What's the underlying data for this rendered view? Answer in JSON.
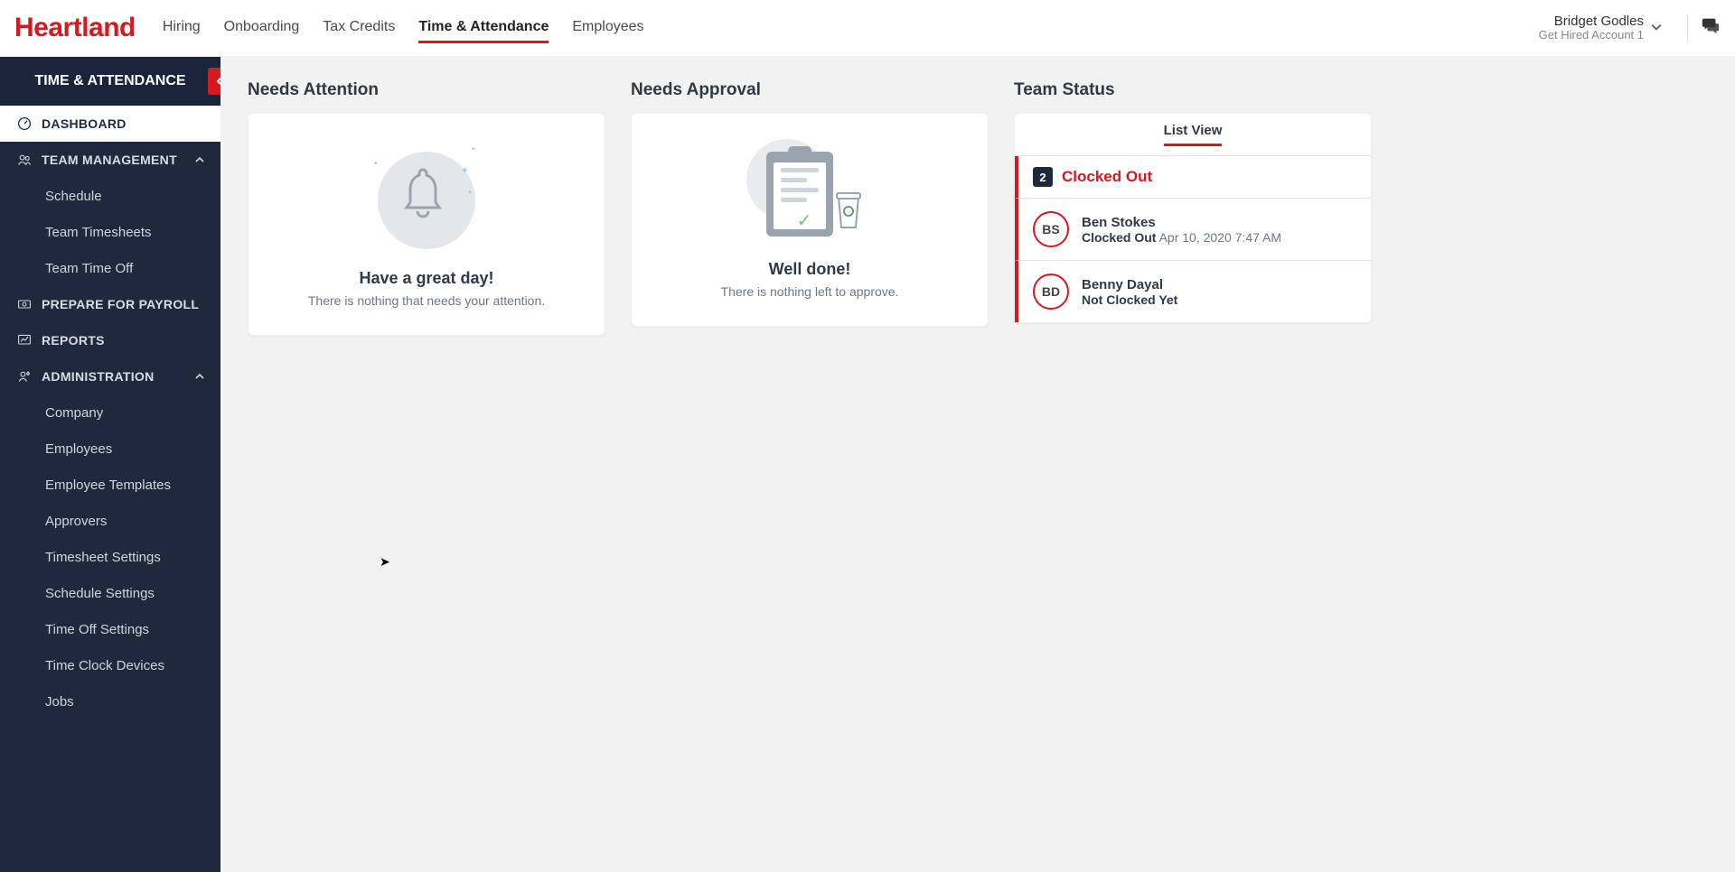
{
  "header": {
    "logo": "Heartland",
    "nav": [
      "Hiring",
      "Onboarding",
      "Tax Credits",
      "Time & Attendance",
      "Employees"
    ],
    "nav_active_index": 3,
    "user_name": "Bridget Godles",
    "user_account": "Get Hired Account 1"
  },
  "sidebar": {
    "title": "TIME & ATTENDANCE",
    "items": [
      {
        "label": "DASHBOARD",
        "type": "section",
        "active": true,
        "icon": "gauge"
      },
      {
        "label": "TEAM MANAGEMENT",
        "type": "section",
        "expanded": true,
        "icon": "users",
        "children": [
          "Schedule",
          "Team Timesheets",
          "Team Time Off"
        ]
      },
      {
        "label": "PREPARE FOR PAYROLL",
        "type": "section",
        "icon": "payroll"
      },
      {
        "label": "REPORTS",
        "type": "section",
        "icon": "chart"
      },
      {
        "label": "ADMINISTRATION",
        "type": "section",
        "expanded": true,
        "icon": "admin",
        "children": [
          "Company",
          "Employees",
          "Employee Templates",
          "Approvers",
          "Timesheet Settings",
          "Schedule Settings",
          "Time Off Settings",
          "Time Clock Devices",
          "Jobs"
        ]
      }
    ]
  },
  "dashboard": {
    "needs_attention": {
      "title": "Needs Attention",
      "empty_title": "Have a great day!",
      "empty_sub": "There is nothing that needs your attention."
    },
    "needs_approval": {
      "title": "Needs Approval",
      "empty_title": "Well done!",
      "empty_sub": "There is nothing left to approve."
    },
    "team_status": {
      "title": "Team Status",
      "tab": "List View",
      "group_label": "Clocked Out",
      "group_count": "2",
      "employees": [
        {
          "initials": "BS",
          "name": "Ben Stokes",
          "status_label": "Clocked Out",
          "status_time": "Apr 10, 2020 7:47 AM"
        },
        {
          "initials": "BD",
          "name": "Benny Dayal",
          "status_label": "Not Clocked Yet",
          "status_time": ""
        }
      ]
    }
  }
}
